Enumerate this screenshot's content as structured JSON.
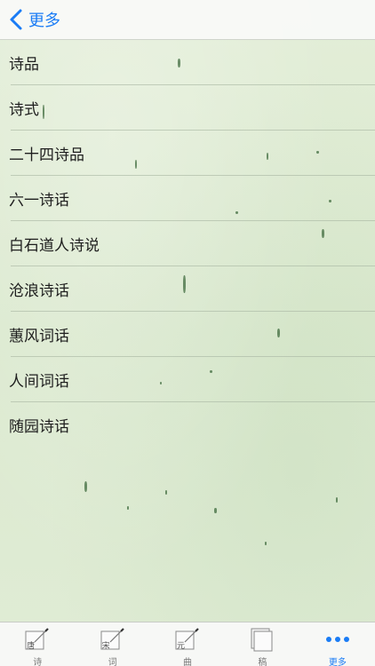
{
  "nav": {
    "back_label": "更多"
  },
  "list": {
    "items": [
      {
        "label": "诗品"
      },
      {
        "label": "诗式"
      },
      {
        "label": "二十四诗品"
      },
      {
        "label": "六一诗话"
      },
      {
        "label": "白石道人诗说"
      },
      {
        "label": "沧浪诗话"
      },
      {
        "label": "蕙风词话"
      },
      {
        "label": "人间词话"
      },
      {
        "label": "随园诗话"
      }
    ]
  },
  "tabbar": {
    "tabs": [
      {
        "label": "诗",
        "icon": "tang-document-icon",
        "icon_char": "唐"
      },
      {
        "label": "词",
        "icon": "song-document-icon",
        "icon_char": "宋"
      },
      {
        "label": "曲",
        "icon": "yuan-document-icon",
        "icon_char": "元"
      },
      {
        "label": "稿",
        "icon": "drafts-stack-icon"
      },
      {
        "label": "更多",
        "icon": "more-dots-icon",
        "active": true
      }
    ]
  },
  "colors": {
    "accent": "#1a7cf5",
    "background": "#dfecd3",
    "text": "#1e1e1e",
    "tab_inactive": "#7a7a7a"
  }
}
